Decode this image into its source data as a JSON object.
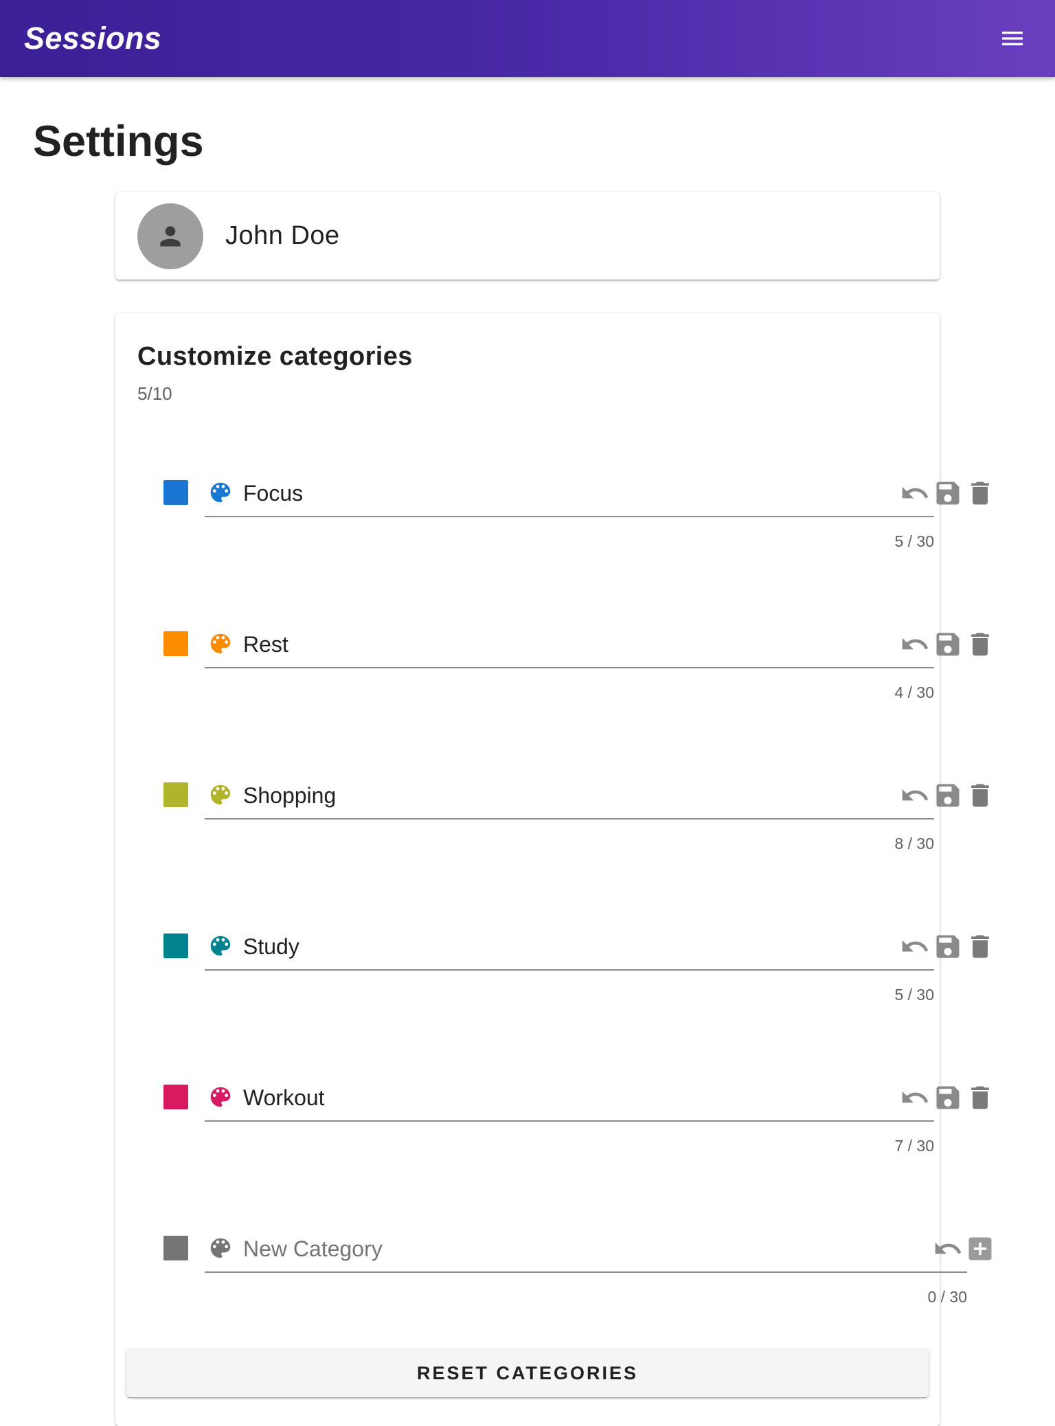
{
  "appbar": {
    "title": "Sessions",
    "menu_icon": "menu-icon",
    "gradient_colors": [
      "#3b1f96",
      "#6a3fbf"
    ]
  },
  "page": {
    "title": "Settings"
  },
  "profile": {
    "avatar_icon": "person-icon",
    "name": "John Doe"
  },
  "categories_section": {
    "title": "Customize categories",
    "count": "5/10",
    "items": [
      {
        "name": "Focus",
        "color": "#1976d2",
        "counter": "5 / 30"
      },
      {
        "name": "Rest",
        "color": "#fb8c00",
        "counter": "4 / 30"
      },
      {
        "name": "Shopping",
        "color": "#afb42b",
        "counter": "8 / 30"
      },
      {
        "name": "Study",
        "color": "#00838f",
        "counter": "5 / 30"
      },
      {
        "name": "Workout",
        "color": "#d81b60",
        "counter": "7 / 30"
      }
    ],
    "new_category": {
      "value": "",
      "placeholder": "New Category",
      "color": "#757575",
      "counter": "0 / 30"
    },
    "row_icons": [
      "palette-icon",
      "undo-icon",
      "save-icon",
      "delete-icon",
      "add-box-icon"
    ],
    "reset_label": "RESET CATEGORIES"
  }
}
